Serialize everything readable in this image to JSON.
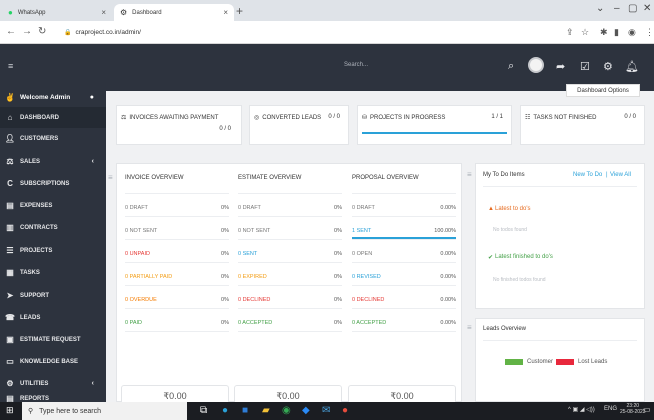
{
  "browser": {
    "tabs": [
      {
        "label": "WhatsApp",
        "active": false
      },
      {
        "label": "Dashboard",
        "active": true
      }
    ],
    "url": "craproject.co.in/admin/"
  },
  "header": {
    "search_placeholder": "Search...",
    "dashboard_options": "Dashboard Options"
  },
  "sidebar": {
    "welcome": "Welcome Admin",
    "items": [
      {
        "label": "DASHBOARD",
        "icon": "home-icon"
      },
      {
        "label": "CUSTOMERS",
        "icon": "user-icon"
      },
      {
        "label": "SALES",
        "icon": "scale-icon"
      },
      {
        "label": "SUBSCRIPTIONS",
        "icon": "c-icon"
      },
      {
        "label": "EXPENSES",
        "icon": "file-icon"
      },
      {
        "label": "CONTRACTS",
        "icon": "contract-icon"
      },
      {
        "label": "PROJECTS",
        "icon": "bars-icon"
      },
      {
        "label": "TASKS",
        "icon": "tasks-icon"
      },
      {
        "label": "SUPPORT",
        "icon": "rocket-icon"
      },
      {
        "label": "LEADS",
        "icon": "tty-icon"
      },
      {
        "label": "ESTIMATE REQUEST",
        "icon": "card-icon"
      },
      {
        "label": "KNOWLEDGE BASE",
        "icon": "folder-icon"
      },
      {
        "label": "UTILITIES",
        "icon": "cogs-icon"
      },
      {
        "label": "REPORTS",
        "icon": "chart-icon"
      }
    ]
  },
  "stats": [
    {
      "title": "INVOICES AWAITING PAYMENT",
      "value": "0 / 0",
      "icon": "balance-icon"
    },
    {
      "title": "CONVERTED LEADS",
      "value": "0 / 0",
      "icon": "target-icon"
    },
    {
      "title": "PROJECTS IN PROGRESS",
      "value": "1 / 1",
      "icon": "cubes-icon",
      "progress": 1.0
    },
    {
      "title": "TASKS NOT FINISHED",
      "value": "0 / 0",
      "icon": "list-icon"
    }
  ],
  "overview": {
    "columns": [
      {
        "title": "INVOICE OVERVIEW",
        "rows": [
          {
            "label": "0 DRAFT",
            "pct": "0%",
            "color": "#777777",
            "fill": 0
          },
          {
            "label": "0 NOT SENT",
            "pct": "0%",
            "color": "#777777",
            "fill": 0
          },
          {
            "label": "0 UNPAID",
            "pct": "0%",
            "color": "#e53935",
            "fill": 0
          },
          {
            "label": "0 PARTIALLY PAID",
            "pct": "0%",
            "color": "#f39c12",
            "fill": 0
          },
          {
            "label": "0 OVERDUE",
            "pct": "0%",
            "color": "#f57c00",
            "fill": 0
          },
          {
            "label": "0 PAID",
            "pct": "0%",
            "color": "#43a047",
            "fill": 0
          }
        ],
        "total": "₹0.00"
      },
      {
        "title": "ESTIMATE OVERVIEW",
        "rows": [
          {
            "label": "0 DRAFT",
            "pct": "0%",
            "color": "#777777",
            "fill": 0
          },
          {
            "label": "0 NOT SENT",
            "pct": "0%",
            "color": "#777777",
            "fill": 0
          },
          {
            "label": "0 SENT",
            "pct": "0%",
            "color": "#2aa1d8",
            "fill": 0
          },
          {
            "label": "0 EXPIRED",
            "pct": "0%",
            "color": "#f39c12",
            "fill": 0
          },
          {
            "label": "0 DECLINED",
            "pct": "0%",
            "color": "#e53935",
            "fill": 0
          },
          {
            "label": "0 ACCEPTED",
            "pct": "0%",
            "color": "#43a047",
            "fill": 0
          }
        ],
        "total": "₹0.00"
      },
      {
        "title": "PROPOSAL OVERVIEW",
        "rows": [
          {
            "label": "0 DRAFT",
            "pct": "0.00%",
            "color": "#777777",
            "fill": 0
          },
          {
            "label": "1 SENT",
            "pct": "100.00%",
            "color": "#2aa1d8",
            "fill": 1
          },
          {
            "label": "0 OPEN",
            "pct": "0.00%",
            "color": "#777777",
            "fill": 0
          },
          {
            "label": "0 REVISED",
            "pct": "0.00%",
            "color": "#2aa1d8",
            "fill": 0
          },
          {
            "label": "0 DECLINED",
            "pct": "0.00%",
            "color": "#e53935",
            "fill": 0
          },
          {
            "label": "0 ACCEPTED",
            "pct": "0.00%",
            "color": "#43a047",
            "fill": 0
          }
        ],
        "total": "₹0.00"
      }
    ]
  },
  "todo": {
    "title": "My To Do Items",
    "new_link": "New To Do",
    "view_all_link": "View All",
    "latest_label": "Latest to do's",
    "no_todos": "No todos found",
    "finished_label": "Latest finished to do's",
    "no_finished": "No finished todos found"
  },
  "leads_overview": {
    "title": "Leads Overview",
    "legend": [
      {
        "name": "Customer",
        "color": "#62b346"
      },
      {
        "name": "Lost Leads",
        "color": "#e8283c"
      }
    ]
  },
  "taskbar": {
    "search_placeholder": "Type here to search",
    "lang": "ENG",
    "time": "23:20",
    "date": "25-08-2023"
  },
  "colors": {
    "sidebar_bg": "#2d333e",
    "accent": "#2aa1d8"
  }
}
